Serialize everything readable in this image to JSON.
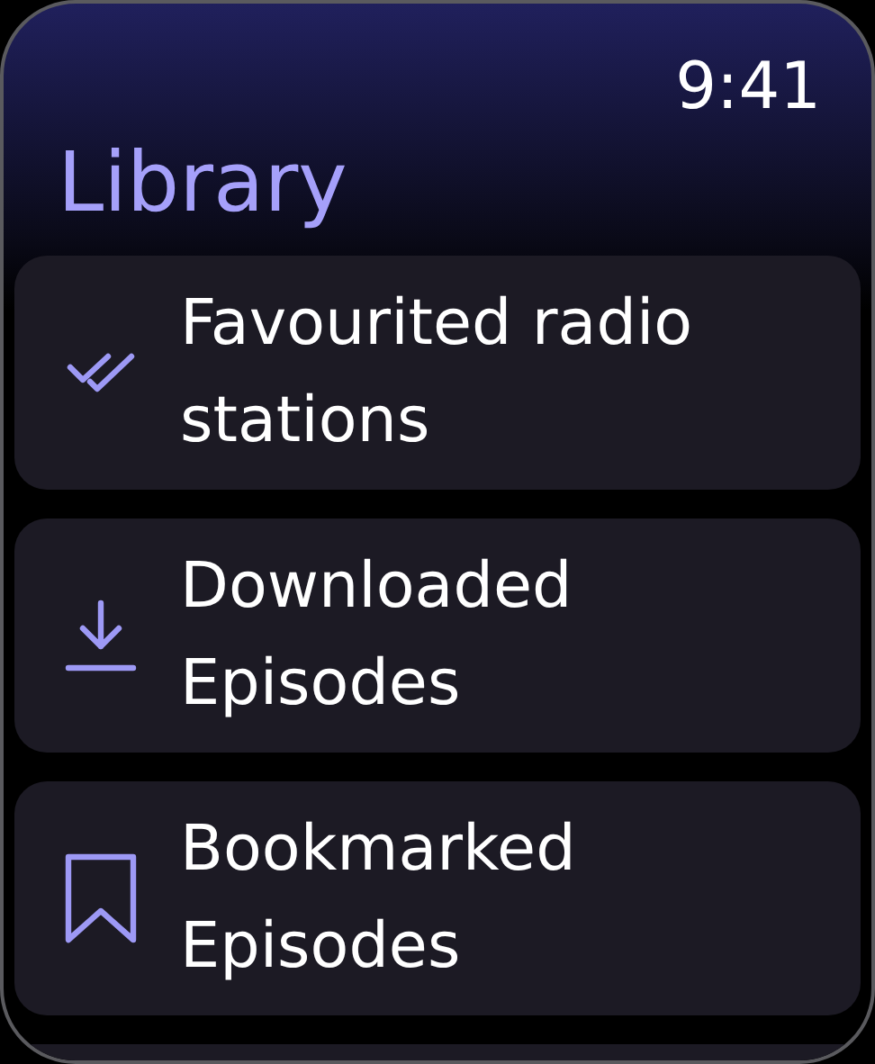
{
  "status_bar": {
    "time": "9:41"
  },
  "title": "Library",
  "items": [
    {
      "kind": "favourites",
      "label": "Favourited radio stations"
    },
    {
      "kind": "downloads",
      "label": "Downloaded Episodes"
    },
    {
      "kind": "bookmarks",
      "label": "Bookmarked Episodes"
    }
  ]
}
